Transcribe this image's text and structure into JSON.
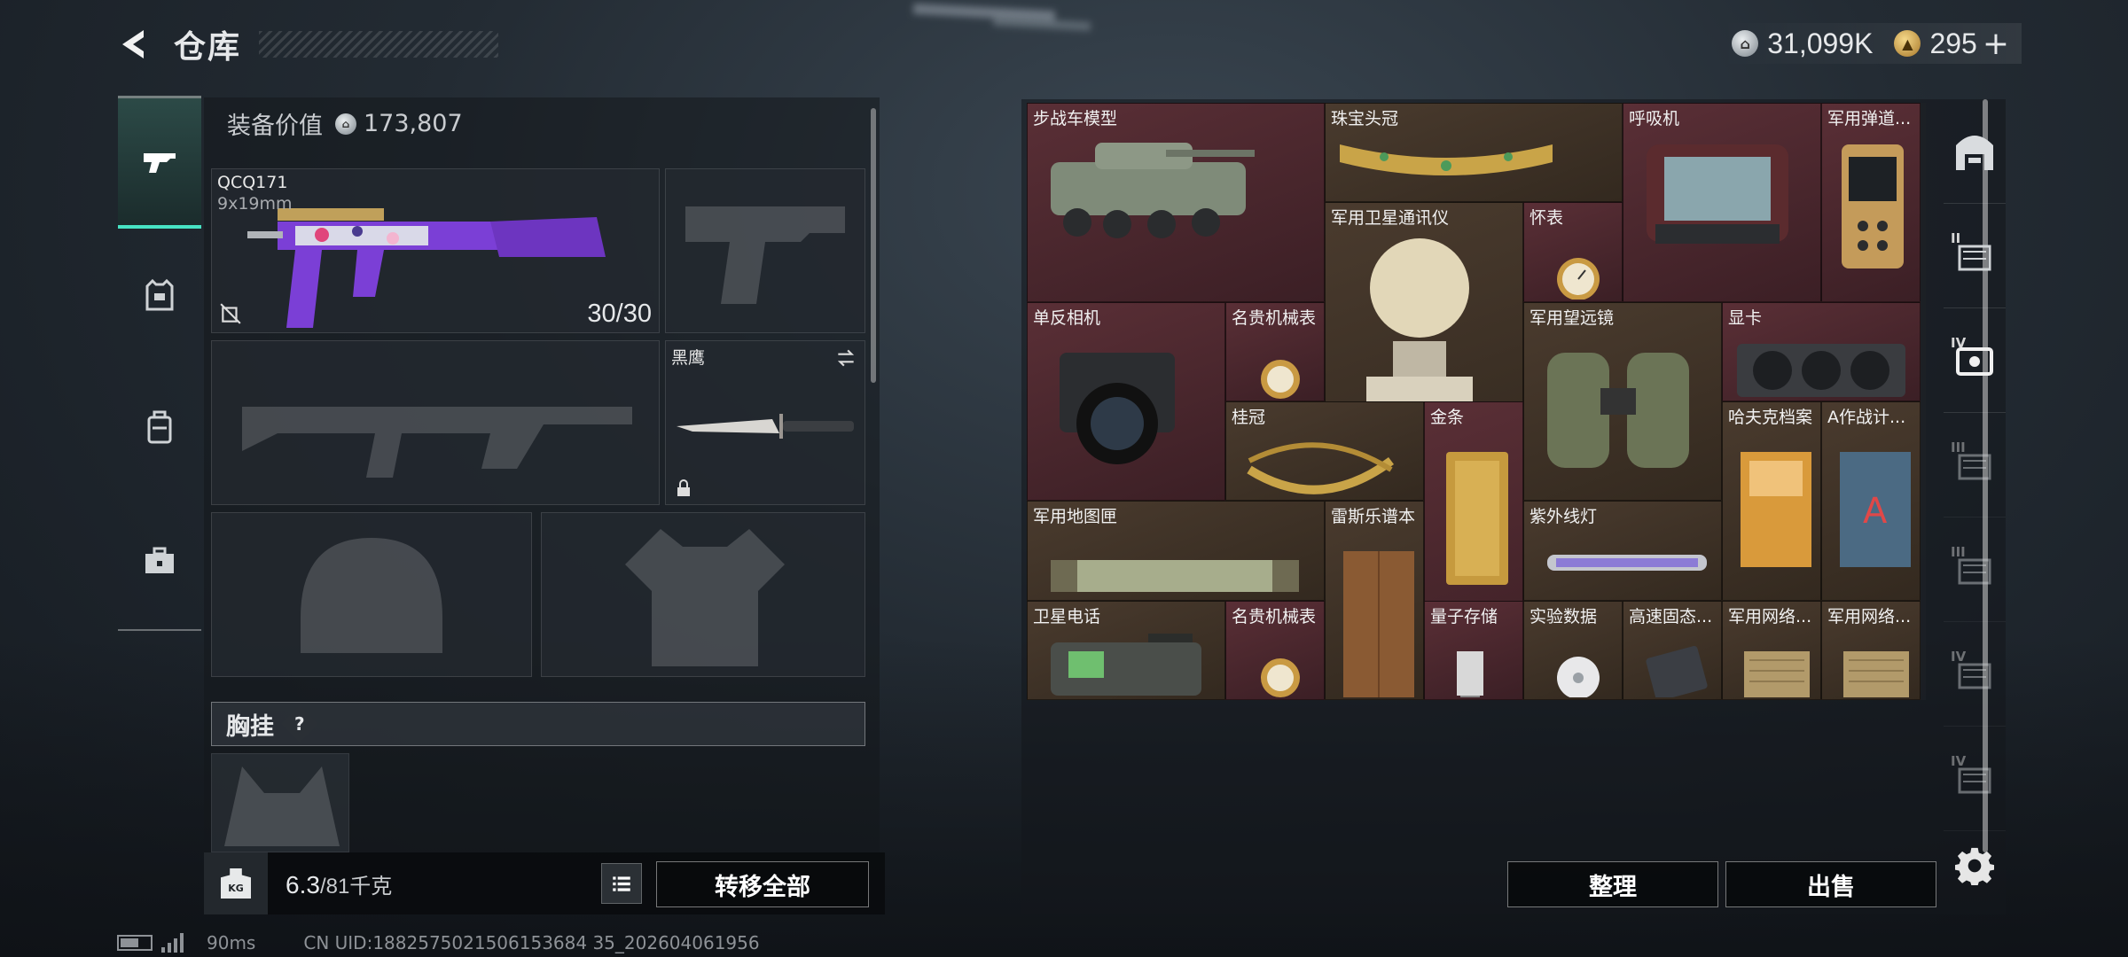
{
  "header": {
    "title": "仓库"
  },
  "currency": {
    "silver": "31,099K",
    "gold": "295",
    "plus": "+"
  },
  "left_tabs": [
    {
      "name": "firearms-tab",
      "icon": "pistol-icon"
    },
    {
      "name": "gear-tab",
      "icon": "armor-vest-icon"
    },
    {
      "name": "container-tab",
      "icon": "backpack-icon"
    },
    {
      "name": "medkit-tab",
      "icon": "toolbox-icon"
    }
  ],
  "loadout": {
    "equip_value_label": "装备价值",
    "equip_value": "173,807",
    "primary": {
      "name": "QCQ171",
      "caliber": "9x19mm",
      "ammo": "30/30"
    },
    "melee": {
      "name": "黑鹰"
    },
    "chest_rig_label": "胸挂",
    "help": "?"
  },
  "bottom": {
    "weight_current": "6.3",
    "weight_max": "/81千克",
    "kg_label": "KG",
    "transfer_all": "转移全部"
  },
  "stash_items": [
    {
      "id": "ifv-model",
      "name": "步战车模型",
      "tint": "red"
    },
    {
      "id": "jewel-crown",
      "name": "珠宝头冠",
      "tint": "gold"
    },
    {
      "id": "respirator",
      "name": "呼吸机",
      "tint": "red"
    },
    {
      "id": "mil-ballistic",
      "name": "军用弹道...",
      "tint": "red"
    },
    {
      "id": "sat-comm",
      "name": "军用卫星通讯仪",
      "tint": "gold"
    },
    {
      "id": "pocket-watch",
      "name": "怀表",
      "tint": "red"
    },
    {
      "id": "dslr",
      "name": "单反相机",
      "tint": "red"
    },
    {
      "id": "luxury-watch-1",
      "name": "名贵机械表",
      "tint": "red"
    },
    {
      "id": "binoculars",
      "name": "军用望远镜",
      "tint": "gold"
    },
    {
      "id": "gpu",
      "name": "显卡",
      "tint": "red"
    },
    {
      "id": "laurel",
      "name": "桂冠",
      "tint": "gold"
    },
    {
      "id": "gold-bar",
      "name": "金条",
      "tint": "red"
    },
    {
      "id": "hafk-files",
      "name": "哈夫克档案",
      "tint": "gold"
    },
    {
      "id": "a-plan",
      "name": "A作战计...",
      "tint": "gold"
    },
    {
      "id": "map-tube",
      "name": "军用地图匣",
      "tint": "gold"
    },
    {
      "id": "rasmus-notebook",
      "name": "雷斯乐谱本",
      "tint": "gold"
    },
    {
      "id": "uv-lamp",
      "name": "紫外线灯",
      "tint": "gold"
    },
    {
      "id": "sat-phone",
      "name": "卫星电话",
      "tint": "gold"
    },
    {
      "id": "luxury-watch-2",
      "name": "名贵机械表",
      "tint": "red"
    },
    {
      "id": "quantum-storage",
      "name": "量子存储",
      "tint": "red"
    },
    {
      "id": "lab-data",
      "name": "实验数据",
      "tint": "gold"
    },
    {
      "id": "ssd",
      "name": "高速固态...",
      "tint": "gold"
    },
    {
      "id": "mil-network-1",
      "name": "军用网络...",
      "tint": "gold"
    },
    {
      "id": "mil-network-2",
      "name": "军用网络...",
      "tint": "gold"
    }
  ],
  "stash_actions": {
    "sort": "整理",
    "sell": "出售"
  },
  "right_tabs": [
    {
      "name": "stash-main-tab",
      "level": ""
    },
    {
      "name": "stash-ii-tab",
      "level": "II"
    },
    {
      "name": "stash-iv-tab",
      "level": "IV"
    },
    {
      "name": "stash-iii-a-tab",
      "level": "III"
    },
    {
      "name": "stash-iii-b-tab",
      "level": "III"
    },
    {
      "name": "stash-iv-b-tab",
      "level": "IV"
    },
    {
      "name": "stash-iv-c-tab",
      "level": "IV"
    }
  ],
  "status": {
    "ping": "90ms",
    "uid": "CN UID:1882575021506153684 35_202604061956"
  },
  "colors": {
    "accent": "#47e3c4",
    "rare_red": "#5a2f36",
    "rare_gold": "#4a3b2e"
  }
}
